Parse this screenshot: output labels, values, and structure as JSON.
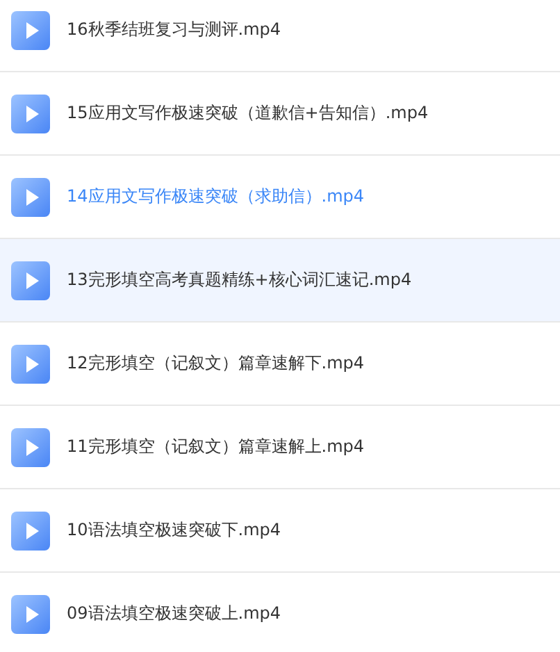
{
  "files": [
    {
      "name": "16秋季结班复习与测评.mp4",
      "selected": false,
      "hovered": false
    },
    {
      "name": "15应用文写作极速突破（道歉信+告知信）.mp4",
      "selected": false,
      "hovered": false
    },
    {
      "name": "14应用文写作极速突破（求助信）.mp4",
      "selected": true,
      "hovered": false
    },
    {
      "name": "13完形填空高考真题精练+核心词汇速记.mp4",
      "selected": false,
      "hovered": true
    },
    {
      "name": "12完形填空（记叙文）篇章速解下.mp4",
      "selected": false,
      "hovered": false
    },
    {
      "name": "11完形填空（记叙文）篇章速解上.mp4",
      "selected": false,
      "hovered": false
    },
    {
      "name": "10语法填空极速突破下.mp4",
      "selected": false,
      "hovered": false
    },
    {
      "name": "09语法填空极速突破上.mp4",
      "selected": false,
      "hovered": false
    }
  ]
}
